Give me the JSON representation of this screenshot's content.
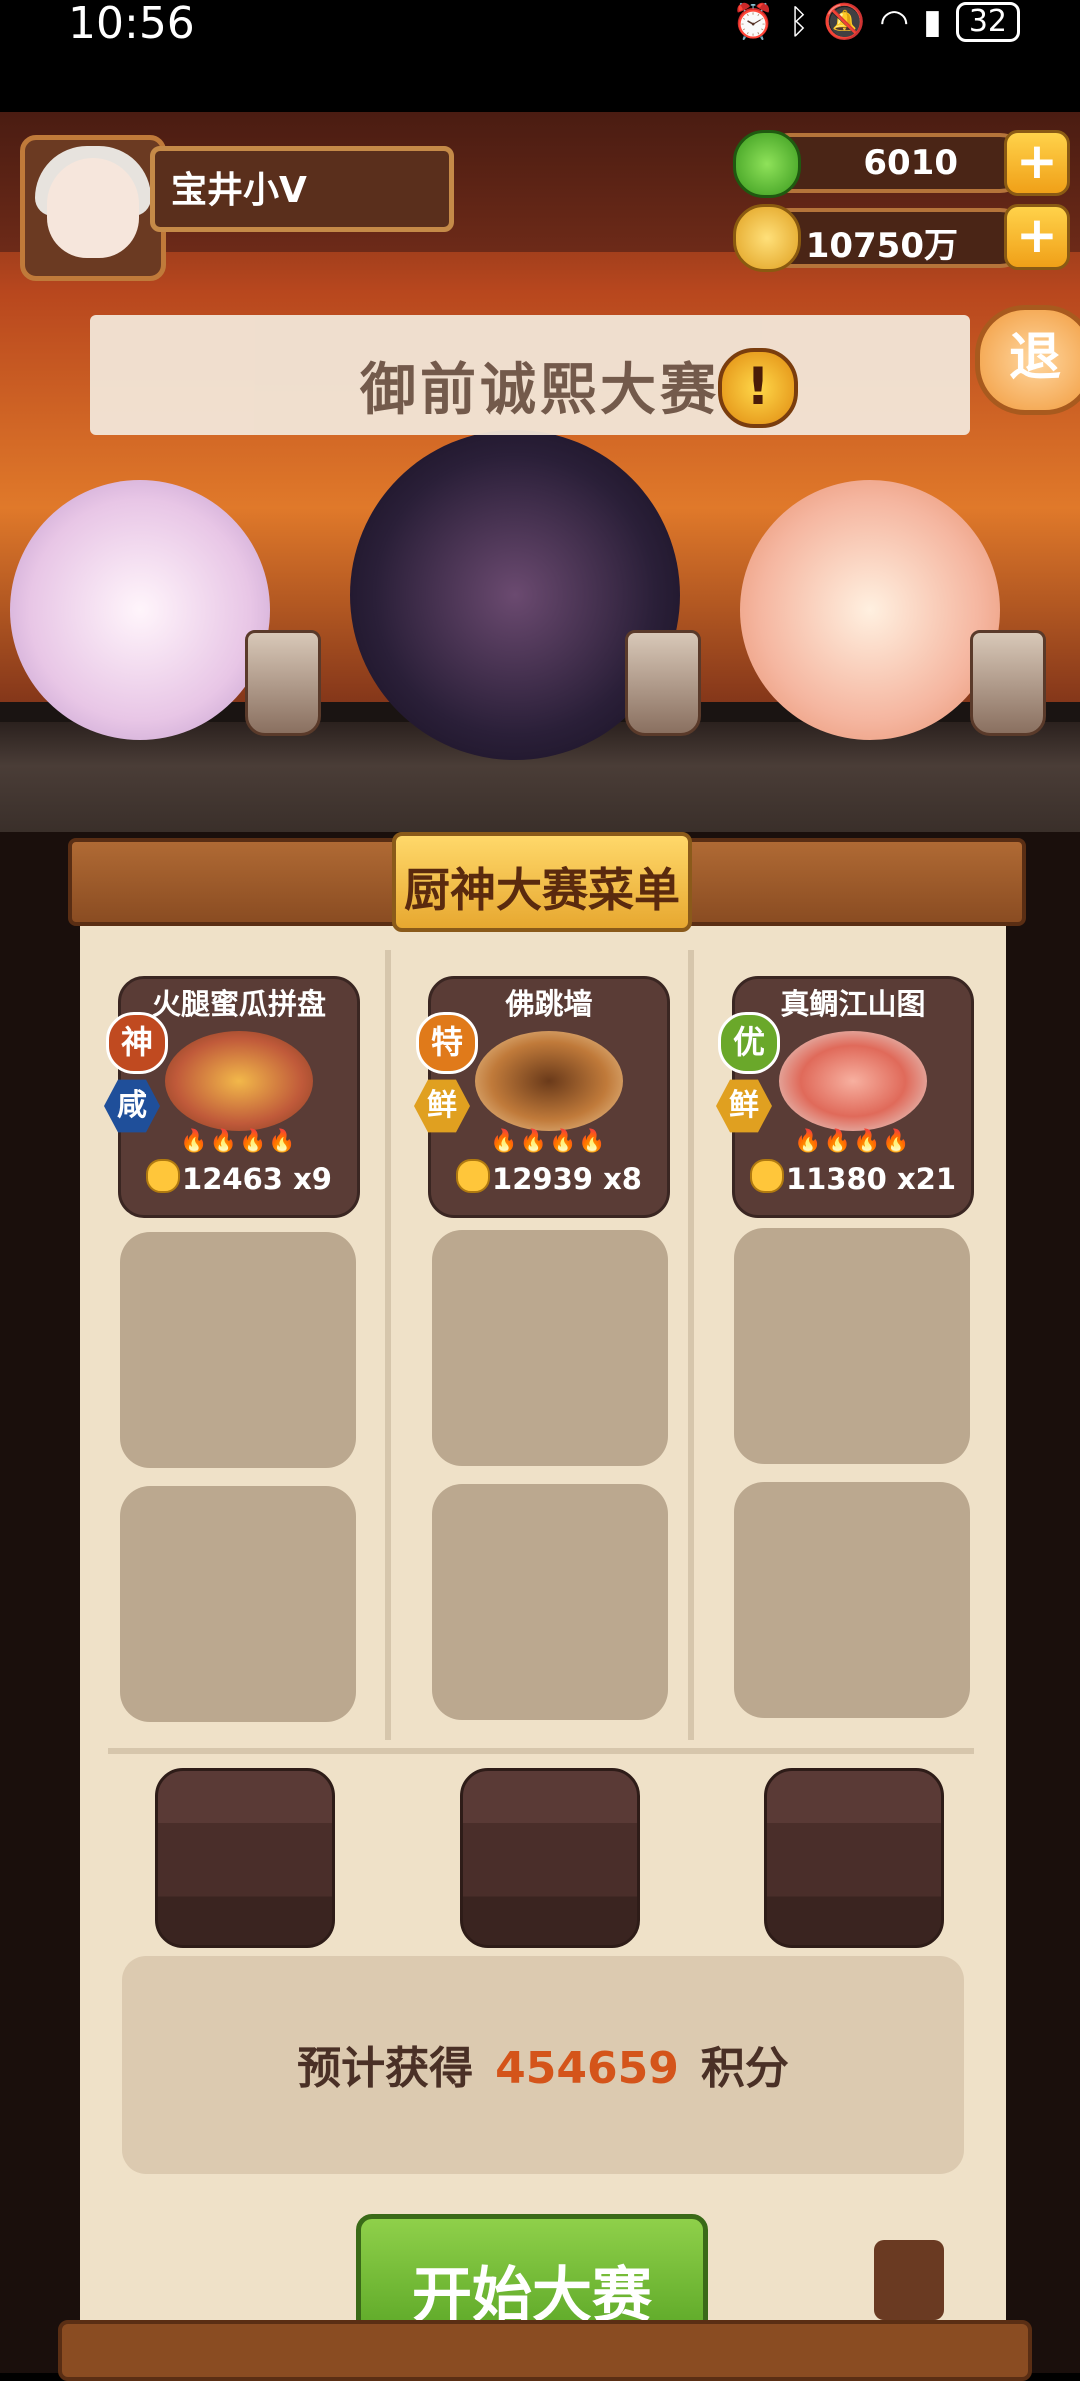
{
  "status_bar": {
    "time": "10:56",
    "battery": "32"
  },
  "player": {
    "name": "宝井小V"
  },
  "resources": {
    "green_currency": "6010",
    "coins": "10750万",
    "plus": "+"
  },
  "banner": {
    "title": "御前诚熙大赛",
    "alert": "!"
  },
  "exit_label": "退",
  "menu": {
    "title": "厨神大赛菜单",
    "dishes": [
      {
        "name": "火腿蜜瓜拼盘",
        "grade": "神",
        "flavor": "咸",
        "score": "12463",
        "count": "x9",
        "grade_color": "#c04a20",
        "flavor_color": "#1f4f9a"
      },
      {
        "name": "佛跳墙",
        "grade": "特",
        "flavor": "鲜",
        "score": "12939",
        "count": "x8",
        "grade_color": "#e07a1a",
        "flavor_color": "#e0a020"
      },
      {
        "name": "真鲷江山图",
        "grade": "优",
        "flavor": "鲜",
        "score": "11380",
        "count": "x21",
        "grade_color": "#6aa82a",
        "flavor_color": "#e0a020"
      }
    ],
    "flames": "🔥🔥🔥🔥"
  },
  "estimate": {
    "prefix": "预计获得",
    "value": "454659",
    "suffix": "积分"
  },
  "start_button": "开始大赛"
}
